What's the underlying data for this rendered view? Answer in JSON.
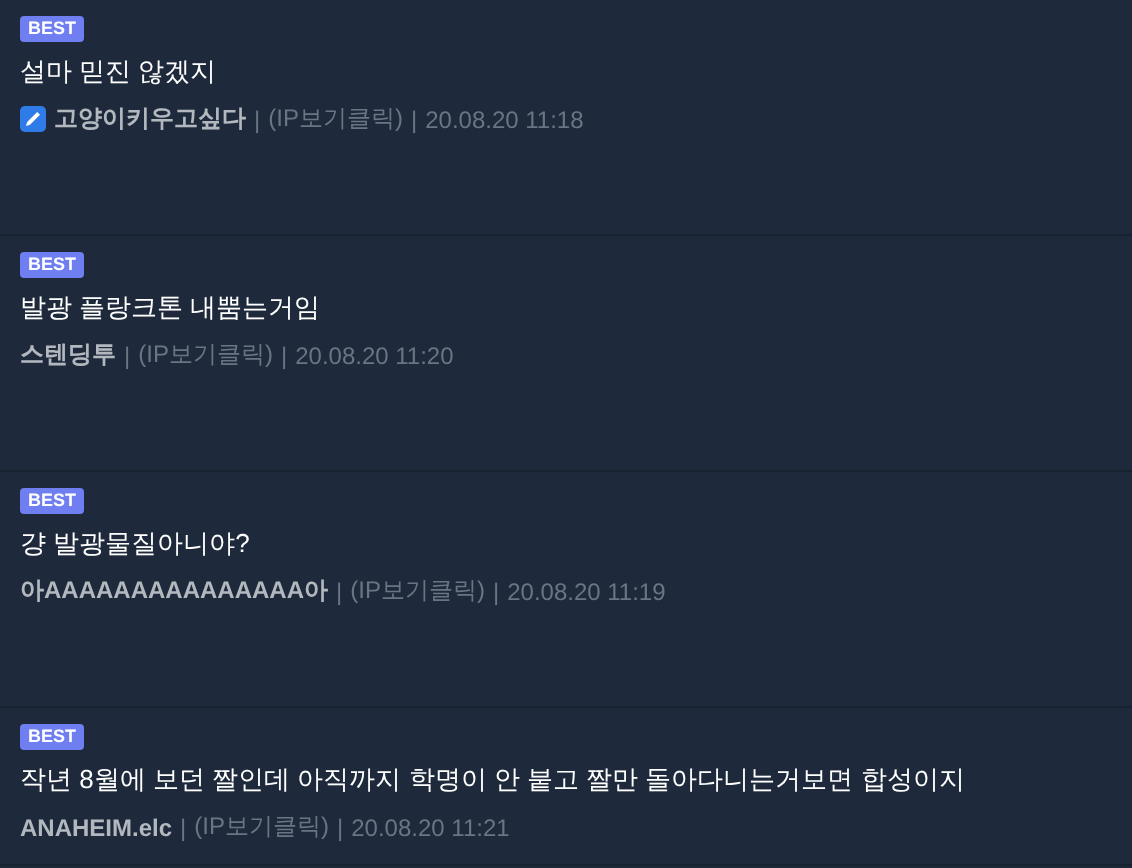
{
  "posts": [
    {
      "badge": "BEST",
      "title": "설마 믿진 않겠지",
      "author": "고양이키우고싶다",
      "verified": true,
      "separators": [
        "|",
        "|"
      ],
      "ip": "(IP보기클릭)",
      "time": "20.08.20 11:18"
    },
    {
      "badge": "BEST",
      "title": "발광 플랑크톤 내뿜는거임",
      "author": "스텐딩투",
      "verified": false,
      "separators": [
        "|",
        "|"
      ],
      "ip": "(IP보기클릭)",
      "time": "20.08.20 11:20"
    },
    {
      "badge": "BEST",
      "title": "걍 발광물질아니야?",
      "author": "아AAAAAAAAAAAAAAA아",
      "verified": false,
      "separators": [
        "|",
        "|"
      ],
      "ip": "(IP보기클릭)",
      "time": "20.08.20 11:19"
    },
    {
      "badge": "BEST",
      "title": "작년 8월에 보던 짤인데 아직까지 학명이 안 붙고 짤만 돌아다니는거보면 합성이지",
      "author": "ANAHEIM.elc",
      "verified": false,
      "separators": [
        "|",
        "|"
      ],
      "ip": "(IP보기클릭)",
      "time": "20.08.20 11:21"
    }
  ]
}
